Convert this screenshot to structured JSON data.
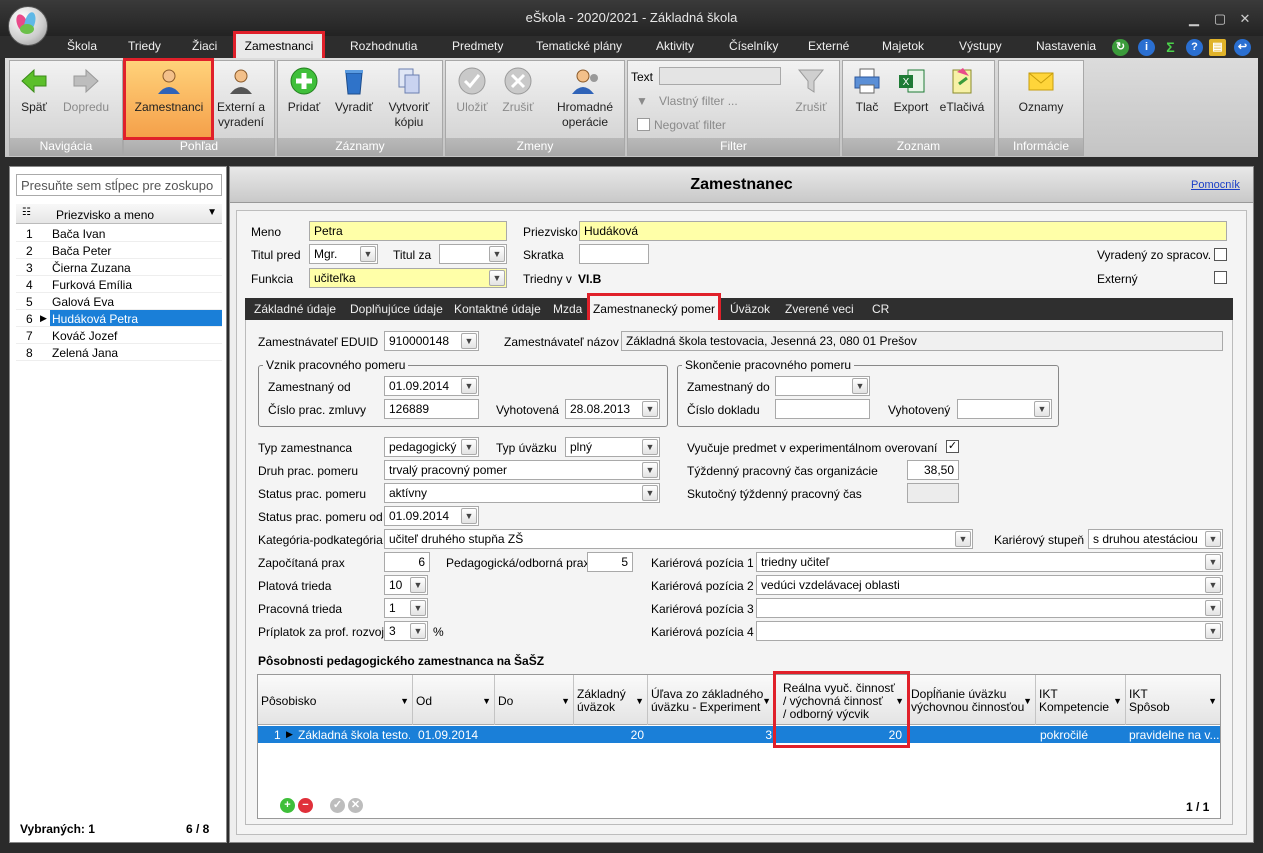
{
  "window": {
    "title": "eŠkola - 2020/2021 - Základná škola"
  },
  "menu": {
    "items": [
      "Škola",
      "Triedy",
      "Žiaci",
      "Zamestnanci",
      "Rozhodnutia",
      "Predmety",
      "Tematické plány",
      "Aktivity",
      "Číselníky",
      "Externé",
      "Majetok",
      "Výstupy",
      "Nastavenia"
    ],
    "active": "Zamestnanci"
  },
  "ribbon": {
    "navigacia": {
      "label": "Navigácia",
      "back": "Späť",
      "forward": "Dopredu"
    },
    "pohlad": {
      "label": "Pohľad",
      "zamestnanci": "Zamestnanci",
      "externi_line1": "Externí a",
      "externi_line2": "vyradení"
    },
    "zaznamy": {
      "label": "Záznamy",
      "pridat": "Pridať",
      "vyradit": "Vyradiť",
      "kopia_line1": "Vytvoriť",
      "kopia_line2": "kópiu"
    },
    "zmeny": {
      "label": "Zmeny",
      "ulozit": "Uložiť",
      "zrusit": "Zrušiť",
      "hrom_line1": "Hromadné",
      "hrom_line2": "operácie"
    },
    "filter": {
      "label": "Filter",
      "text_label": "Text",
      "vlastny": "Vlastný filter ...",
      "negovat": "Negovať filter",
      "zrusit": "Zrušiť"
    },
    "zoznam": {
      "label": "Zoznam",
      "tlac": "Tlač",
      "export": "Export",
      "etlaciva": "eTlačivá"
    },
    "informacie": {
      "label": "Informácie",
      "oznamy": "Oznamy"
    }
  },
  "left": {
    "group_placeholder": "Presuňte sem stĺpec pre zoskupo",
    "column": "Priezvisko a meno",
    "rows": [
      {
        "n": "1",
        "name": "Bača Ivan"
      },
      {
        "n": "2",
        "name": "Bača Peter"
      },
      {
        "n": "3",
        "name": "Čierna Zuzana"
      },
      {
        "n": "4",
        "name": "Furková Emília"
      },
      {
        "n": "5",
        "name": "Galová Eva"
      },
      {
        "n": "6",
        "name": "Hudáková Petra"
      },
      {
        "n": "7",
        "name": "Kováč Jozef"
      },
      {
        "n": "8",
        "name": "Zelená Jana"
      }
    ],
    "selected_index": 5,
    "footer_selected": "Vybraných: 1",
    "footer_count": "6 / 8"
  },
  "main": {
    "title": "Zamestnanec",
    "help": "Pomocník",
    "header": {
      "meno_label": "Meno",
      "meno": "Petra",
      "priezvisko_label": "Priezvisko",
      "priezvisko": "Hudáková",
      "titul_pred_label": "Titul pred",
      "titul_pred": "Mgr.",
      "titul_za_label": "Titul za",
      "titul_za": "",
      "skratka_label": "Skratka",
      "skratka": "",
      "vyradeny_label": "Vyradený zo spracov.",
      "funkcia_label": "Funkcia",
      "funkcia": "učiteľka",
      "triedny_label": "Triedny v",
      "triedny": "VI.B",
      "externy_label": "Externý"
    },
    "tabs": [
      "Základné údaje",
      "Doplňujúce údaje",
      "Kontaktné údaje",
      "Mzda",
      "Zamestnanecký pomer",
      "Úväzok",
      "Zverené veci",
      "CR"
    ],
    "active_tab": "Zamestnanecký pomer",
    "pomer": {
      "edu_label": "Zamestnávateľ EDUID",
      "edu": "910000148",
      "nazov_label": "Zamestnávateľ názov",
      "nazov": "Základná škola testovacia, Jesenná 23, 080 01 Prešov",
      "vznik_legend": "Vznik pracovného pomeru",
      "od_label": "Zamestnaný od",
      "od": "01.09.2014",
      "cislo_label": "Číslo prac. zmluvy",
      "cislo": "126889",
      "vyhot_label": "Vyhotovená",
      "vyhot": "28.08.2013",
      "skonc_legend": "Skončenie pracovného pomeru",
      "do_label": "Zamestnaný do",
      "do": "",
      "dokl_label": "Číslo dokladu",
      "dokl": "",
      "vyhot2_label": "Vyhotovený",
      "vyhot2": "",
      "typ_label": "Typ zamestnanca",
      "typ": "pedagogický",
      "typuv_label": "Typ úväzku",
      "typuv": "plný",
      "exp_label": "Vyučuje predmet v experimentálnom overovaní",
      "druh_label": "Druh prac. pomeru",
      "druh": "trvalý pracovný pomer",
      "tyzd_label": "Týždenný pracovný čas organizácie",
      "tyzd": "38,50",
      "status_label": "Status prac. pomeru",
      "status": "aktívny",
      "skut_label": "Skutočný týždenný pracovný čas",
      "skut": "",
      "statusod_label": "Status prac. pomeru od",
      "statusod": "01.09.2014",
      "kat_label": "Kategória-podkategória",
      "kat": "učiteľ druhého stupňa ZŠ",
      "karst_label": "Kariérový stupeň",
      "karst": "s druhou atestáciou",
      "zapoc_label": "Započítaná prax",
      "zapoc": "6",
      "pedprax_label": "Pedagogická/odborná prax",
      "pedprax": "5",
      "kp1_label": "Kariérová pozícia 1",
      "kp1": "triedny učiteľ",
      "plat_label": "Platová trieda",
      "plat": "10",
      "kp2_label": "Kariérová pozícia 2",
      "kp2": "vedúci vzdelávacej oblasti",
      "prac_label": "Pracovná trieda",
      "prac": "1",
      "kp3_label": "Kariérová pozícia 3",
      "kp3": "",
      "prip_label": "Príplatok za prof. rozvoj",
      "prip": "3",
      "prip_unit": "%",
      "kp4_label": "Kariérová pozícia 4",
      "kp4": ""
    },
    "grid": {
      "title": "Pôsobnosti pedagogického zamestnanca na ŠaŠZ",
      "cols": {
        "posobisko": "Pôsobisko",
        "od": "Od",
        "do": "Do",
        "zakl1": "Základný",
        "zakl2": "úväzok",
        "ulava1": "Úľava zo základného",
        "ulava2": "úväzku - Experiment",
        "realna1": "Reálna vyuč. činnosť",
        "realna2": "/ výchovná činnosť",
        "realna3": "/ odborný výcvik",
        "dopl1": "Dopĺňanie úväzku",
        "dopl2": "výchovnou činnosťou",
        "iktk1": "IKT",
        "iktk2": "Kompetencie",
        "ikts1": "IKT",
        "ikts2": "Spôsob"
      },
      "row": {
        "n": "1",
        "posobisko": "Základná škola testo...",
        "od": "01.09.2014",
        "do": "",
        "zakl": "20",
        "ulava": "3",
        "realna": "20",
        "dopl": "",
        "iktk": "pokročilé",
        "ikts": "pravidelne na v..."
      },
      "pager": "1 / 1"
    }
  },
  "colors": {
    "highlight": "#e0202a",
    "selection": "#1a7fd8",
    "required": "#ffffa8"
  }
}
